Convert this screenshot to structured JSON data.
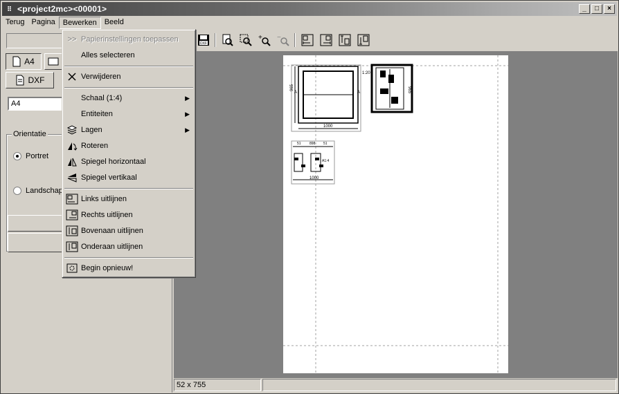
{
  "window": {
    "title": "<project2mc><00001>"
  },
  "menubar": {
    "items": [
      "Terug",
      "Pagina",
      "Bewerken",
      "Beeld"
    ]
  },
  "left_panel": {
    "size_button": "A4",
    "dxf_button": "DXF",
    "paper_value": "A4",
    "orientation_label": "Orientatie",
    "portrait_label": "Portret",
    "landscape_label": "Landschap"
  },
  "status": {
    "size_text": "52 x 755"
  },
  "drawings": {
    "d1_width": "1000",
    "d1_height": "965",
    "d1_label_a": "A",
    "d2_scale": "1:20",
    "d2_height": "965",
    "d3_dims": [
      "51",
      "898",
      "51"
    ],
    "d3_width": "1000",
    "d3_scale": "A1:4"
  },
  "dropdown": {
    "items": [
      {
        "label": "Papierinstellingen toepassen",
        "icon": "chevrons-icon",
        "disabled": true
      },
      {
        "label": "Alles selecteren",
        "icon": "",
        "disabled": false
      },
      {
        "label": "Verwijderen",
        "icon": "x-icon",
        "disabled": false
      },
      {
        "label": "Schaal (1:4)",
        "icon": "",
        "submenu": true
      },
      {
        "label": "Entiteiten",
        "icon": "",
        "submenu": true
      },
      {
        "label": "Lagen",
        "icon": "layers-icon",
        "submenu": true
      },
      {
        "label": "Roteren",
        "icon": "rotate-icon"
      },
      {
        "label": "Spiegel horizontaal",
        "icon": "mirror-h-icon"
      },
      {
        "label": "Spiegel vertikaal",
        "icon": "mirror-v-icon"
      },
      {
        "label": "Links uitlijnen",
        "icon": "align-left-icon"
      },
      {
        "label": "Rechts uitlijnen",
        "icon": "align-right-icon"
      },
      {
        "label": "Bovenaan uitlijnen",
        "icon": "align-top-icon"
      },
      {
        "label": "Onderaan uitlijnen",
        "icon": "align-bottom-icon"
      },
      {
        "label": "Begin opnieuw!",
        "icon": "restart-icon"
      }
    ]
  }
}
